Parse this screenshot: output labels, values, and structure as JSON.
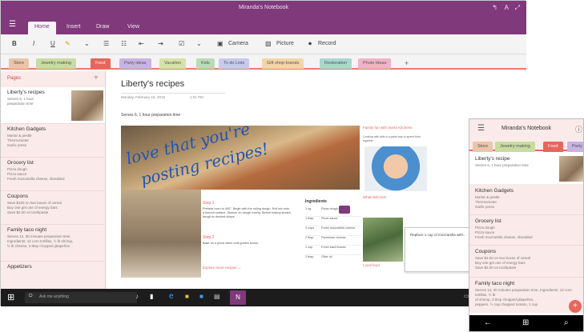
{
  "window": {
    "title": "Miranda's Notebook"
  },
  "menu": {
    "hamburger": "☰",
    "tabs": [
      "Home",
      "Insert",
      "Draw",
      "View"
    ]
  },
  "window_controls": [
    "↰",
    "A",
    "⤢"
  ],
  "ribbon": {
    "bold": "B",
    "italic": "I",
    "underline": "U",
    "camera": "Camera",
    "picture": "Picture",
    "record": "Record"
  },
  "sections": [
    "Store",
    "Jewelry making",
    "Food",
    "Party ideas",
    "Vacation",
    "Kids",
    "To do Lists",
    "Gift shop brands",
    "Restoration",
    "Photo Ideas"
  ],
  "add_section": "+",
  "pages": {
    "header": "Pages",
    "add": "+",
    "items": [
      {
        "title": "Liberty's recipes",
        "sub": "Serves 6, 1 hour\npreparation time"
      },
      {
        "title": "Kitchen Gadgets",
        "sub": "Mortar & pestle\nThermometer\nGarlic press"
      },
      {
        "title": "Grocery list",
        "sub": "Pizza dough\nPizza sauce\nFresh mozzarella cheese, shredded"
      },
      {
        "title": "Coupons",
        "sub": "Save $100 on two boxes of cereal\nBuy one get one of energy bars\nSave $2.00 on toothpaste"
      },
      {
        "title": "Family taco night",
        "sub": "Serves 12, 30 minutes preparation time\nIngredients: 12 corn tortillas, ½ lb shrimp,\n½ lb cheese, 3 tbsp chopped jalapeños"
      },
      {
        "title": "Appetizers",
        "sub": ""
      }
    ]
  },
  "note": {
    "title": "Liberty's recipes",
    "date": "Monday, February 16, 2015",
    "time": "1:01 PM",
    "serves": "Serves 6, 1 hour preparation time",
    "ink": [
      "love that you're",
      "posting recipes!"
    ],
    "step1_title": "Step 1",
    "step1_text": "Preheat oven to 400°. Begin with the rolling dough. Roll out onto a floured surface. Season on dough evenly. Before baking stretch dough to desired shape.",
    "step2_title": "Step 2",
    "step2_text": "Bake on a pizza stone until golden brown.",
    "more": "Explore more recipes →",
    "ingredients_title": "Ingredients",
    "ingredients": [
      [
        "1 kg",
        "Pizza dough"
      ],
      [
        "1 tbsp",
        "Pizza sauce"
      ],
      [
        "3 cups",
        "Fresh mozzarella cheese"
      ],
      [
        "2 tbsp",
        "Parmesan cheese"
      ],
      [
        "1 cup",
        "Fresh basil leaves"
      ],
      [
        "1 tbsp",
        "Olive oil"
      ]
    ],
    "right_title": "Family fun with Swiss Kitchens",
    "right_text": "Cooking with kids is a great way to spend time together.",
    "right_sub": "What kids love",
    "right_food": "Local food",
    "comment": "Replace 1 cup of mozzarella with..."
  },
  "taskbar": {
    "search_placeholder": "Ask me anything"
  },
  "phone": {
    "title": "Miranda's Notebook",
    "hamburger": "☰",
    "tabs": [
      "Store",
      "Jewelry making",
      "Food",
      "Party"
    ],
    "pages": [
      {
        "title": "Liberty's recipe",
        "sub": "Serves 6, 1 hour preparation time"
      },
      {
        "title": "Kitchen Gadgets",
        "sub": "Mortar & pestle\nThermometer\nGarlic press"
      },
      {
        "title": "Grocery list",
        "sub": "Pizza dough\nPizza sauce\nFresh mozzarella cheese, shredded"
      },
      {
        "title": "Coupons",
        "sub": "Save $2.00 on two boxes of cereal\nBuy one get one of energy bars\nSave $2.00 on toothpaste"
      },
      {
        "title": "Family taco night",
        "sub": "Serves 12, 30 minutes preparation time, Ingredients: 12 corn tortillas, ½ lb\nof shrimp, 3 tbsp chopped jalapeños,\npeppers, ½ cup chopped tomato, 1 cup"
      }
    ],
    "nav": [
      "←",
      "⊞",
      "⌕"
    ]
  },
  "colors": {
    "purple": "#80397b",
    "food_tab": "#e8655c",
    "pages_bg": "#fbeaea"
  }
}
